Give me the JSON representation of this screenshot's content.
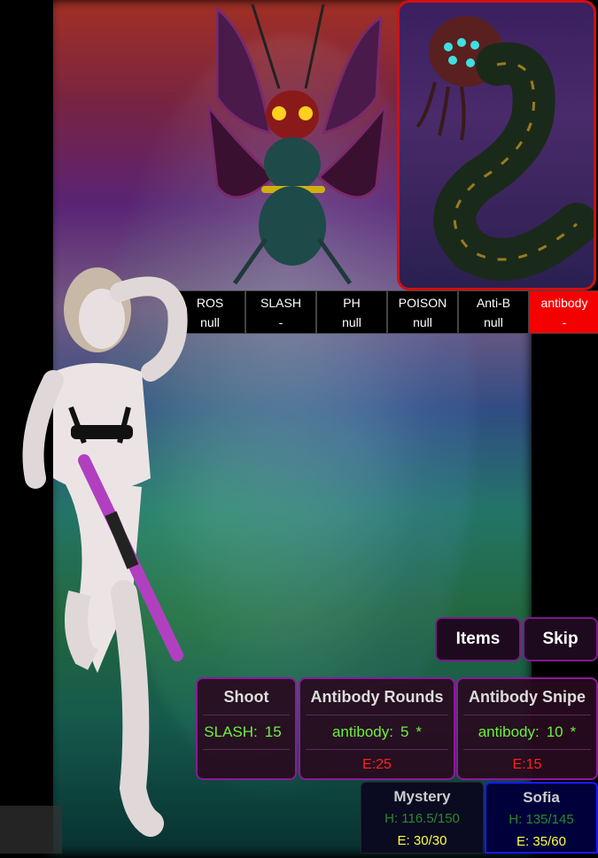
{
  "enemies": [
    {
      "name": "moth-enemy"
    },
    {
      "name": "worm-enemy",
      "selected": true
    }
  ],
  "status": [
    {
      "label": "ROS",
      "value": "null"
    },
    {
      "label": "SLASH",
      "value": "-"
    },
    {
      "label": "PH",
      "value": "null"
    },
    {
      "label": "POISON",
      "value": "null"
    },
    {
      "label": "Anti-B",
      "value": "null"
    },
    {
      "label": "antibody",
      "value": "-",
      "active": true
    }
  ],
  "commands": {
    "items": "Items",
    "skip": "Skip"
  },
  "skills": [
    {
      "name": "Shoot",
      "stat": "SLASH:",
      "value": "15",
      "star": "",
      "cost": ""
    },
    {
      "name": "Antibody Rounds",
      "stat": "antibody:",
      "value": "5",
      "star": "*",
      "cost": "E:25"
    },
    {
      "name": "Antibody Snipe",
      "stat": "antibody:",
      "value": "10",
      "star": "*",
      "cost": "E:15"
    }
  ],
  "party": [
    {
      "name": "Mystery",
      "hp": "H: 116.5/150",
      "energy": "E: 30/30"
    },
    {
      "name": "Sofia",
      "hp": "H: 135/145",
      "energy": "E: 35/60"
    }
  ],
  "colors": {
    "active": "#f40000",
    "border": "#8a1a9a",
    "selected": "#d01010"
  }
}
